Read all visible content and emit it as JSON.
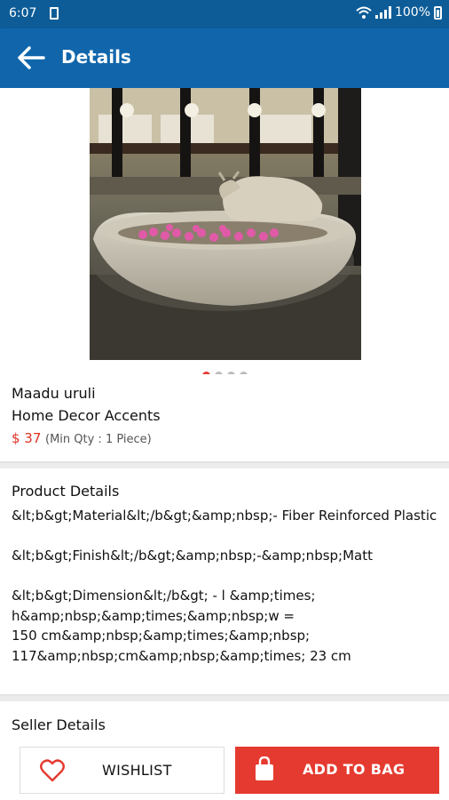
{
  "status_bar": {
    "time": "6:07",
    "battery": "100%"
  },
  "app_bar": {
    "title": "Details",
    "back_icon": "arrow-left-icon"
  },
  "carousel": {
    "image_alt": "Maadu uruli",
    "total_images": 4,
    "active_index": 0
  },
  "product": {
    "name": "Maadu uruli",
    "category": "Home Decor Accents",
    "price": "$ 37",
    "min_qty": "(Min Qty : 1 Piece)"
  },
  "product_details": {
    "heading": "Product Details",
    "text": "&lt;b&gt;Material&lt;/b&gt;&amp;nbsp;- Fiber Reinforced Plastic\n\n&lt;b&gt;Finish&lt;/b&gt;&amp;nbsp;-&amp;nbsp;Matt\n\n&lt;b&gt;Dimension&lt;/b&gt; - l &amp;times;\nh&amp;nbsp;&amp;times;&amp;nbsp;w =\n150 cm&amp;nbsp;&amp;times;&amp;nbsp;\n117&amp;nbsp;cm&amp;nbsp;&amp;times; 23 cm"
  },
  "seller_details": {
    "heading": "Seller Details"
  },
  "actions": {
    "wishlist_label": "WISHLIST",
    "add_to_bag_label": "ADD TO BAG"
  },
  "colors": {
    "app_bar": "#1166ab",
    "status_bar": "#0d5c97",
    "accent_red": "#e53a2f",
    "price_red": "#e02f23"
  }
}
